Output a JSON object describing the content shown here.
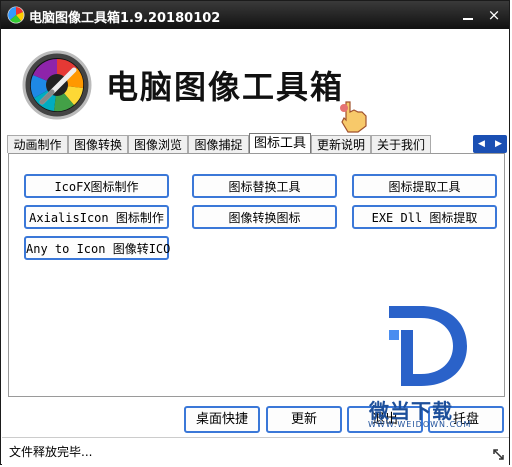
{
  "window": {
    "title": "电脑图像工具箱1.9.20180102",
    "minimize_icon": "minimize-icon",
    "close_label": "×"
  },
  "banner": {
    "app_name": "电脑图像工具箱",
    "logo_icon": "color-picker-logo-icon",
    "cursor_icon": "hand-cursor-icon"
  },
  "tabs": [
    {
      "label": "动画制作"
    },
    {
      "label": "图像转换"
    },
    {
      "label": "图像浏览"
    },
    {
      "label": "图像捕捉"
    },
    {
      "label": "图标工具"
    },
    {
      "label": "更新说明"
    },
    {
      "label": "关于我们"
    }
  ],
  "active_tab": "图标工具",
  "tab_scroll": {
    "left": "◀",
    "right": "▶"
  },
  "tools": {
    "icofx": "IcoFX图标制作",
    "icon_replace": "图标替换工具",
    "icon_extract": "图标提取工具",
    "axialis": "AxialisIcon 图标制作",
    "image_to_icon": "图像转换图标",
    "exe_dll": "EXE Dll 图标提取",
    "any_to_icon": "Any to Icon 图像转ICO"
  },
  "actions": {
    "desktop_shortcut": "桌面快捷",
    "update": "更新",
    "exit": "退出",
    "tray": "托盘"
  },
  "watermark": {
    "text": "微当下载",
    "url": "WWW.WEIDOWN.COM"
  },
  "status": {
    "text": "文件释放完毕..."
  },
  "colors": {
    "accent": "#3b78d8",
    "titlebar": "#1e1e1e",
    "tab_scroll": "#1a4fb3"
  }
}
